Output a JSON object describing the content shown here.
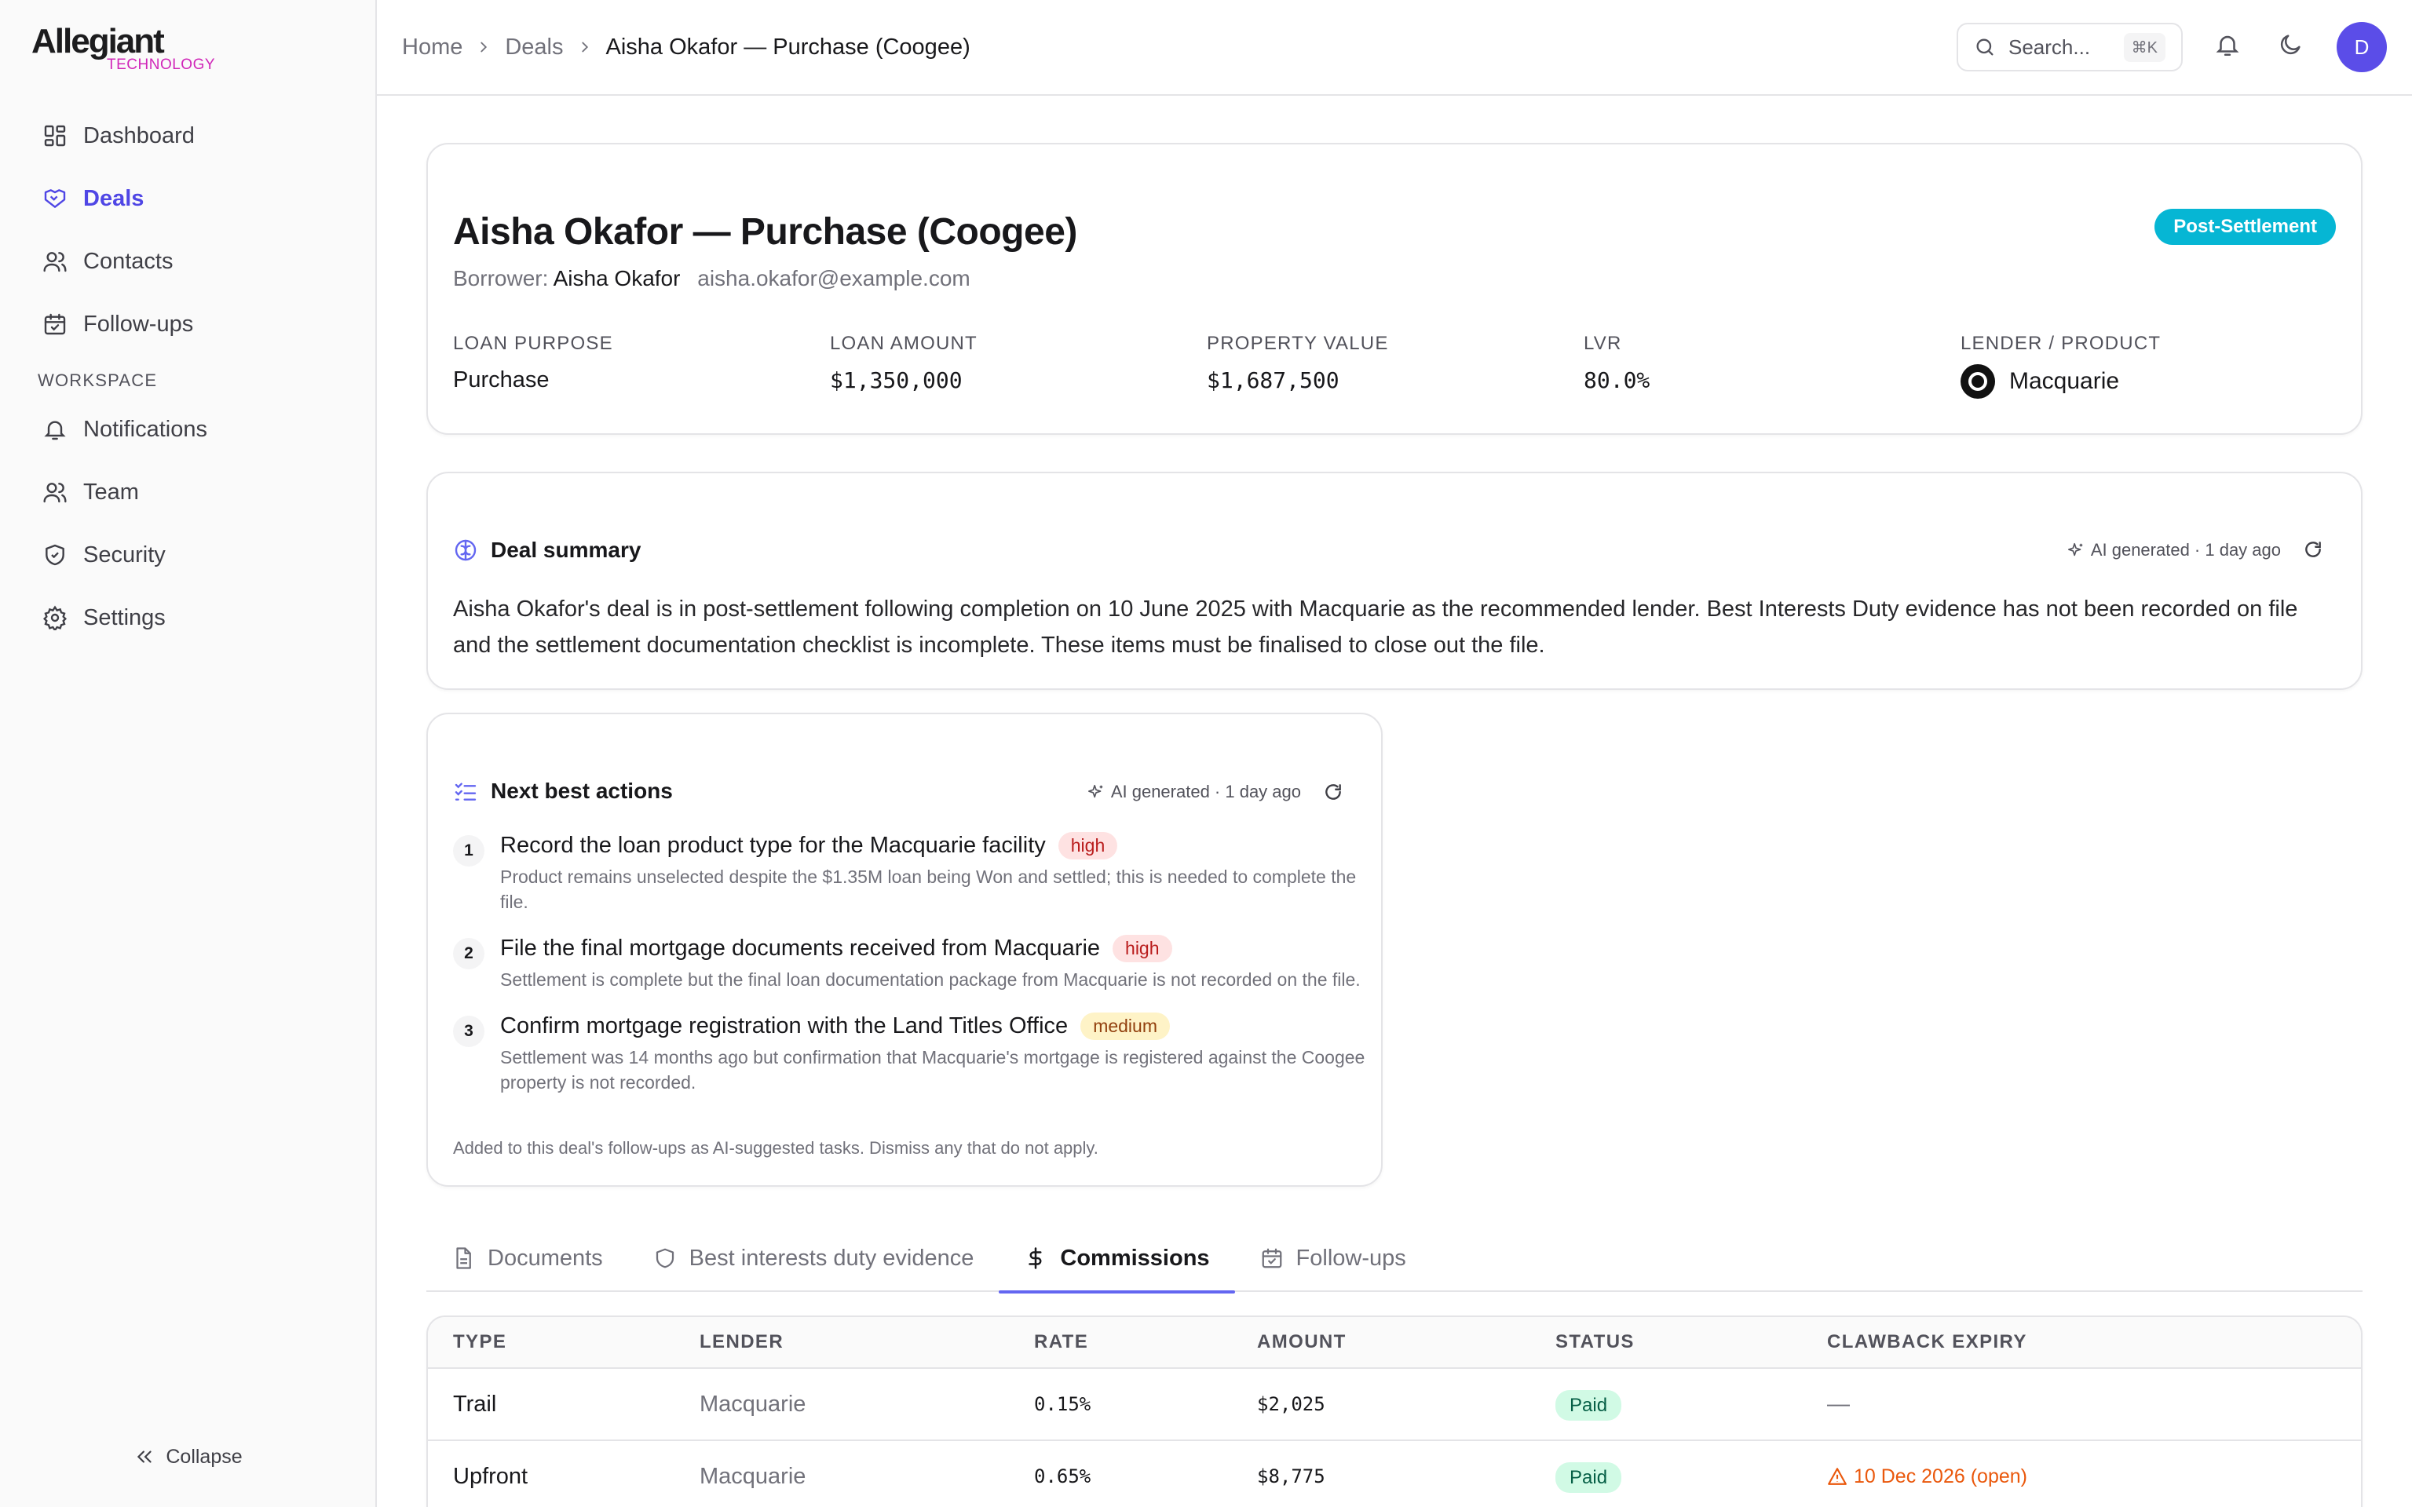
{
  "brand": {
    "name": "Allegiant",
    "sub": "TECHNOLOGY"
  },
  "sidebar": {
    "items": [
      {
        "label": "Dashboard",
        "icon": "dashboard-icon"
      },
      {
        "label": "Deals",
        "icon": "handshake-icon",
        "active": true
      },
      {
        "label": "Contacts",
        "icon": "contacts-icon"
      },
      {
        "label": "Follow-ups",
        "icon": "calendar-check-icon"
      }
    ],
    "section_label": "WORKSPACE",
    "workspace_items": [
      {
        "label": "Notifications",
        "icon": "bell-icon"
      },
      {
        "label": "Team",
        "icon": "team-icon"
      },
      {
        "label": "Security",
        "icon": "shield-icon"
      },
      {
        "label": "Settings",
        "icon": "gear-icon"
      }
    ],
    "collapse_label": "Collapse"
  },
  "topbar": {
    "breadcrumb": [
      "Home",
      "Deals",
      "Aisha Okafor — Purchase (Coogee)"
    ],
    "search_placeholder": "Search...",
    "search_shortcut": "⌘K",
    "avatar_initial": "D"
  },
  "deal": {
    "title": "Aisha Okafor — Purchase (Coogee)",
    "status": "Post-Settlement",
    "status_color": "#06b6d4",
    "borrower_label": "Borrower:",
    "borrower_name": "Aisha Okafor",
    "borrower_email": "aisha.okafor@example.com",
    "metrics": [
      {
        "label": "LOAN PURPOSE",
        "value": "Purchase",
        "mono": false
      },
      {
        "label": "LOAN AMOUNT",
        "value": "$1,350,000",
        "mono": true
      },
      {
        "label": "PROPERTY VALUE",
        "value": "$1,687,500",
        "mono": true
      },
      {
        "label": "LVR",
        "value": "80.0%",
        "mono": true
      }
    ],
    "lender_label": "LENDER / PRODUCT",
    "lender_name": "Macquarie"
  },
  "summary": {
    "title": "Deal summary",
    "ai_meta": "AI generated · 1 day ago",
    "text": "Aisha Okafor's deal is in post-settlement following completion on 10 June 2025 with Macquarie as the recommended lender. Best Interests Duty evidence has not been recorded on file and the settlement documentation checklist is incomplete. These items must be finalised to close out the file."
  },
  "nba": {
    "title": "Next best actions",
    "ai_meta": "AI generated · 1 day ago",
    "items": [
      {
        "num": "1",
        "title": "Record the loan product type for the Macquarie facility",
        "priority": "high",
        "desc": "Product remains unselected despite the $1.35M loan being Won and settled; this is needed to complete the file."
      },
      {
        "num": "2",
        "title": "File the final mortgage documents received from Macquarie",
        "priority": "high",
        "desc": "Settlement is complete but the final loan documentation package from Macquarie is not recorded on the file."
      },
      {
        "num": "3",
        "title": "Confirm mortgage registration with the Land Titles Office",
        "priority": "medium",
        "desc": "Settlement was 14 months ago but confirmation that Macquarie's mortgage is registered against the Coogee property is not recorded."
      }
    ],
    "footer": "Added to this deal's follow-ups as AI-suggested tasks. Dismiss any that do not apply."
  },
  "tabs": [
    {
      "label": "Documents",
      "icon": "document-icon"
    },
    {
      "label": "Best interests duty evidence",
      "icon": "shield-icon"
    },
    {
      "label": "Commissions",
      "icon": "dollar-icon",
      "active": true
    },
    {
      "label": "Follow-ups",
      "icon": "calendar-check-icon"
    }
  ],
  "commissions": {
    "headers": [
      "TYPE",
      "LENDER",
      "RATE",
      "AMOUNT",
      "STATUS",
      "CLAWBACK EXPIRY"
    ],
    "rows": [
      {
        "type": "Trail",
        "lender": "Macquarie",
        "rate": "0.15%",
        "amount": "$2,025",
        "status": "Paid",
        "clawback": "—",
        "clawback_open": false
      },
      {
        "type": "Upfront",
        "lender": "Macquarie",
        "rate": "0.65%",
        "amount": "$8,775",
        "status": "Paid",
        "clawback": "10 Dec 2026 (open)",
        "clawback_open": true
      }
    ]
  }
}
